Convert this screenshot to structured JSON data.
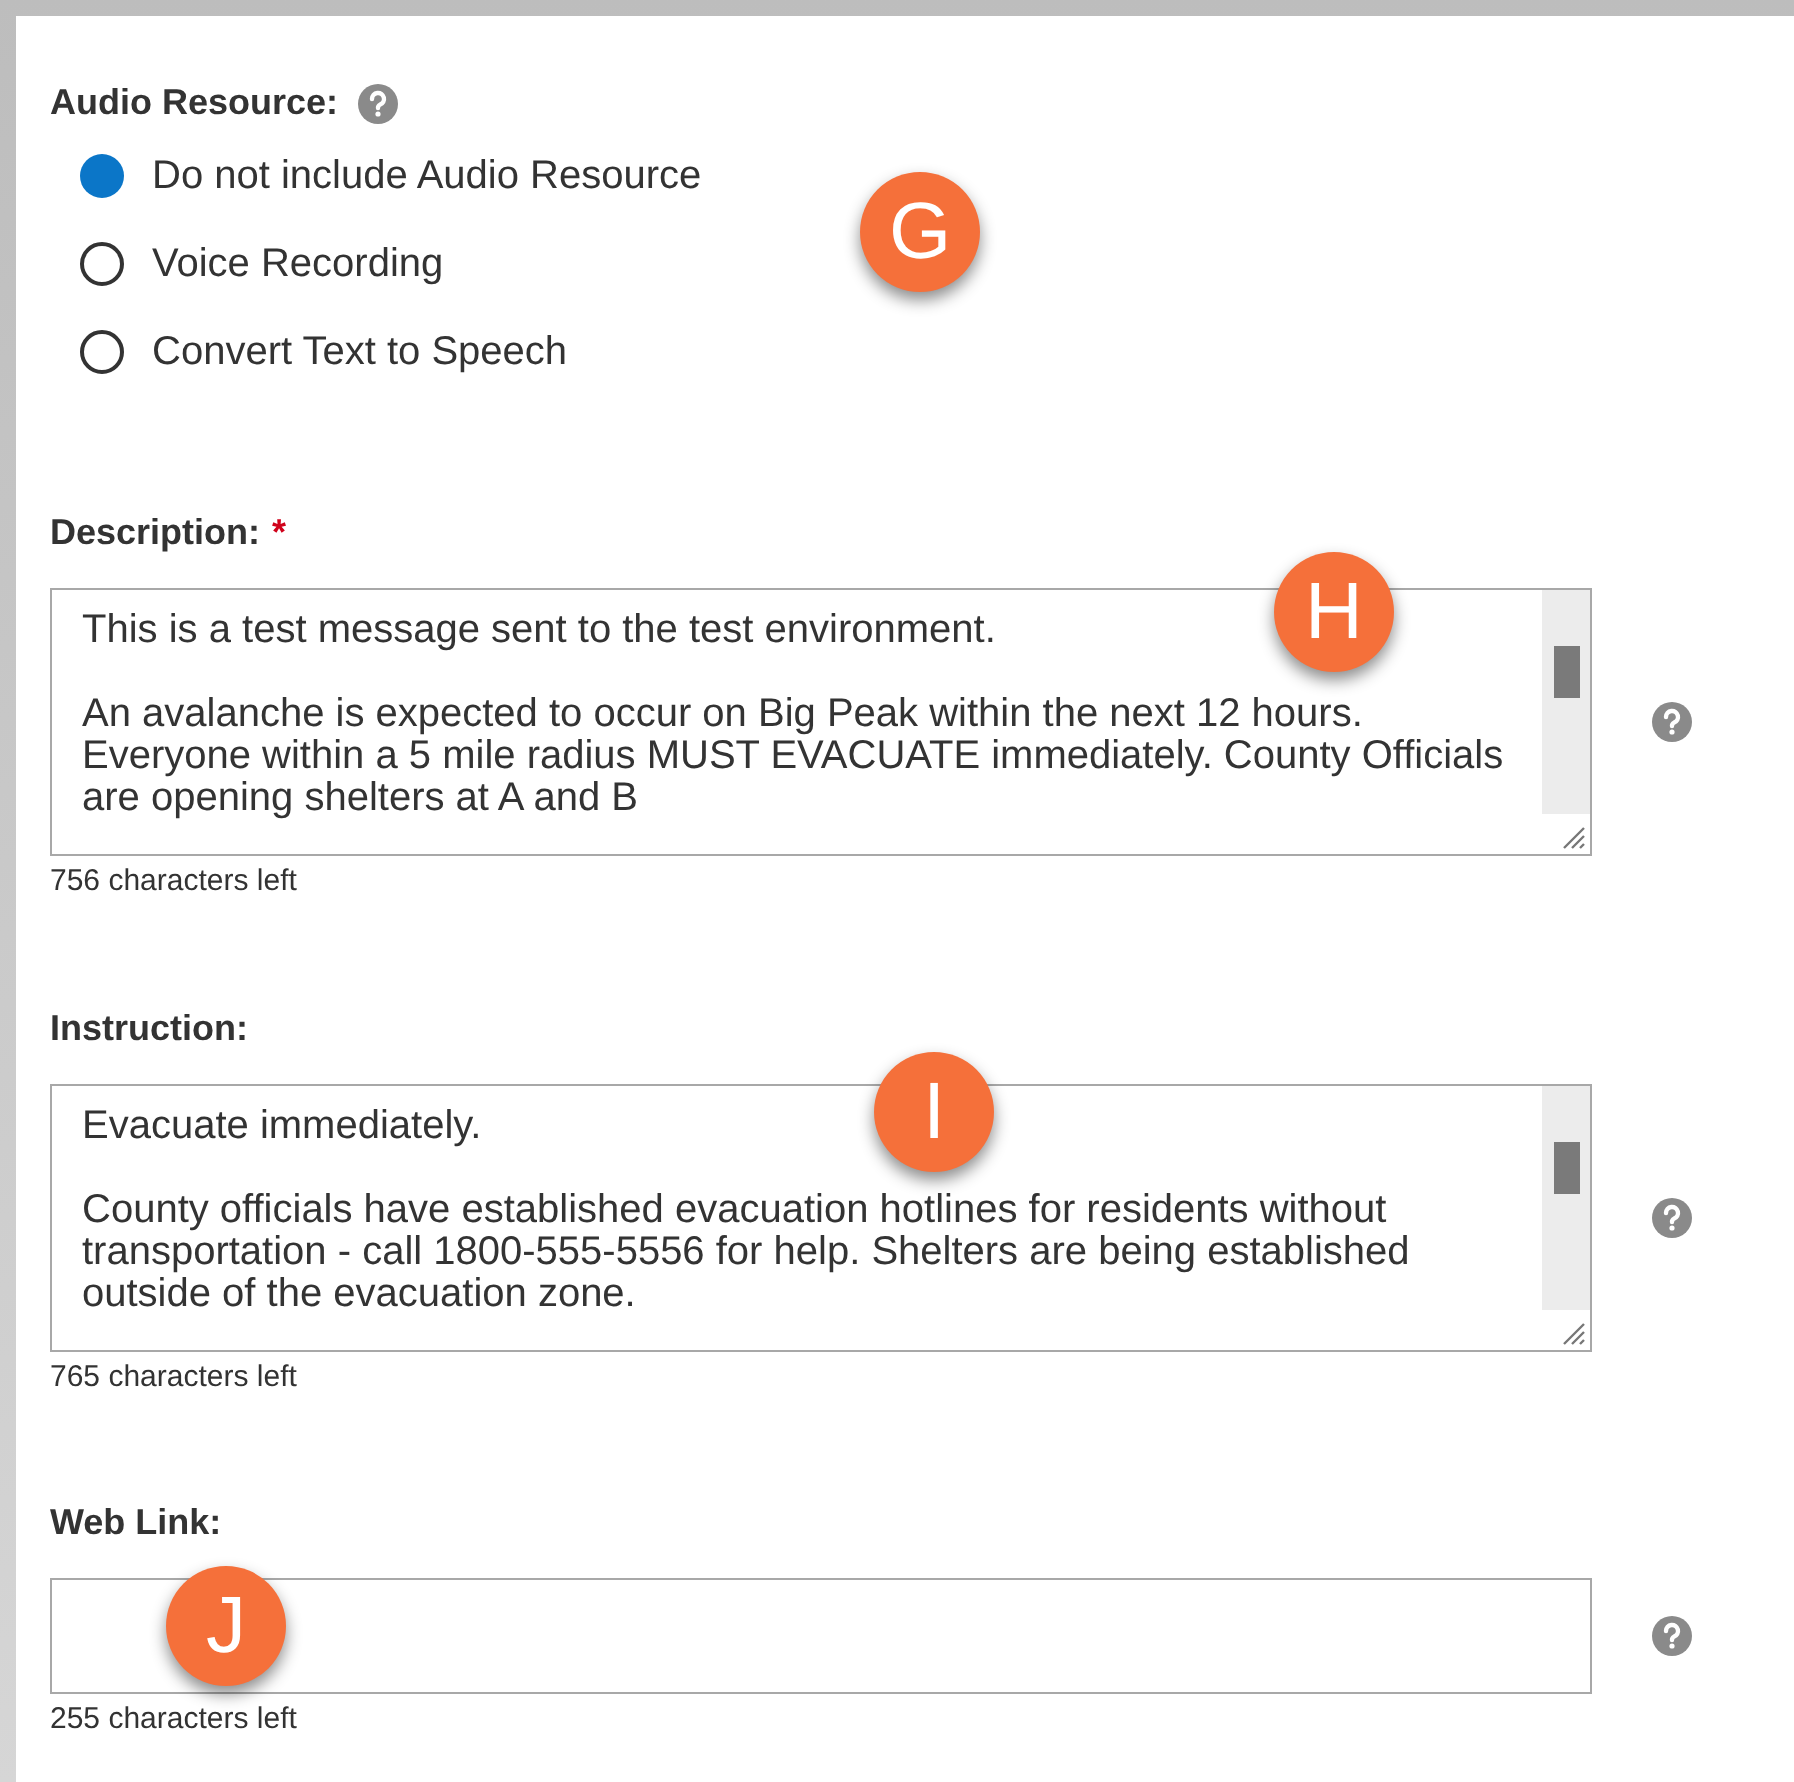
{
  "audio_resource": {
    "label": "Audio Resource:",
    "callout": "G",
    "options": [
      {
        "label": "Do not include Audio Resource",
        "selected": true
      },
      {
        "label": "Voice Recording",
        "selected": false
      },
      {
        "label": "Convert Text to Speech",
        "selected": false
      }
    ]
  },
  "fields": [
    {
      "kind": "textarea",
      "label": "Description:",
      "required_mark": "*",
      "callout": "H",
      "paragraphs": [
        "This is a test message sent to the test environment.",
        "An avalanche is expected to occur on Big Peak within the next 12 hours. Everyone within a 5 mile radius MUST EVACUATE immediately. County Officials are opening shelters at A and B"
      ],
      "counter": "756 characters left"
    },
    {
      "kind": "textarea",
      "label": "Instruction:",
      "callout": "I",
      "paragraphs": [
        "Evacuate immediately.",
        "County officials have established evacuation hotlines for residents without transportation - call 1800-555-5556 for help. Shelters are being established outside of the evacuation zone."
      ],
      "counter": "765 characters left"
    },
    {
      "kind": "input",
      "label": "Web Link:",
      "callout": "J",
      "counter": "255 characters left"
    }
  ]
}
